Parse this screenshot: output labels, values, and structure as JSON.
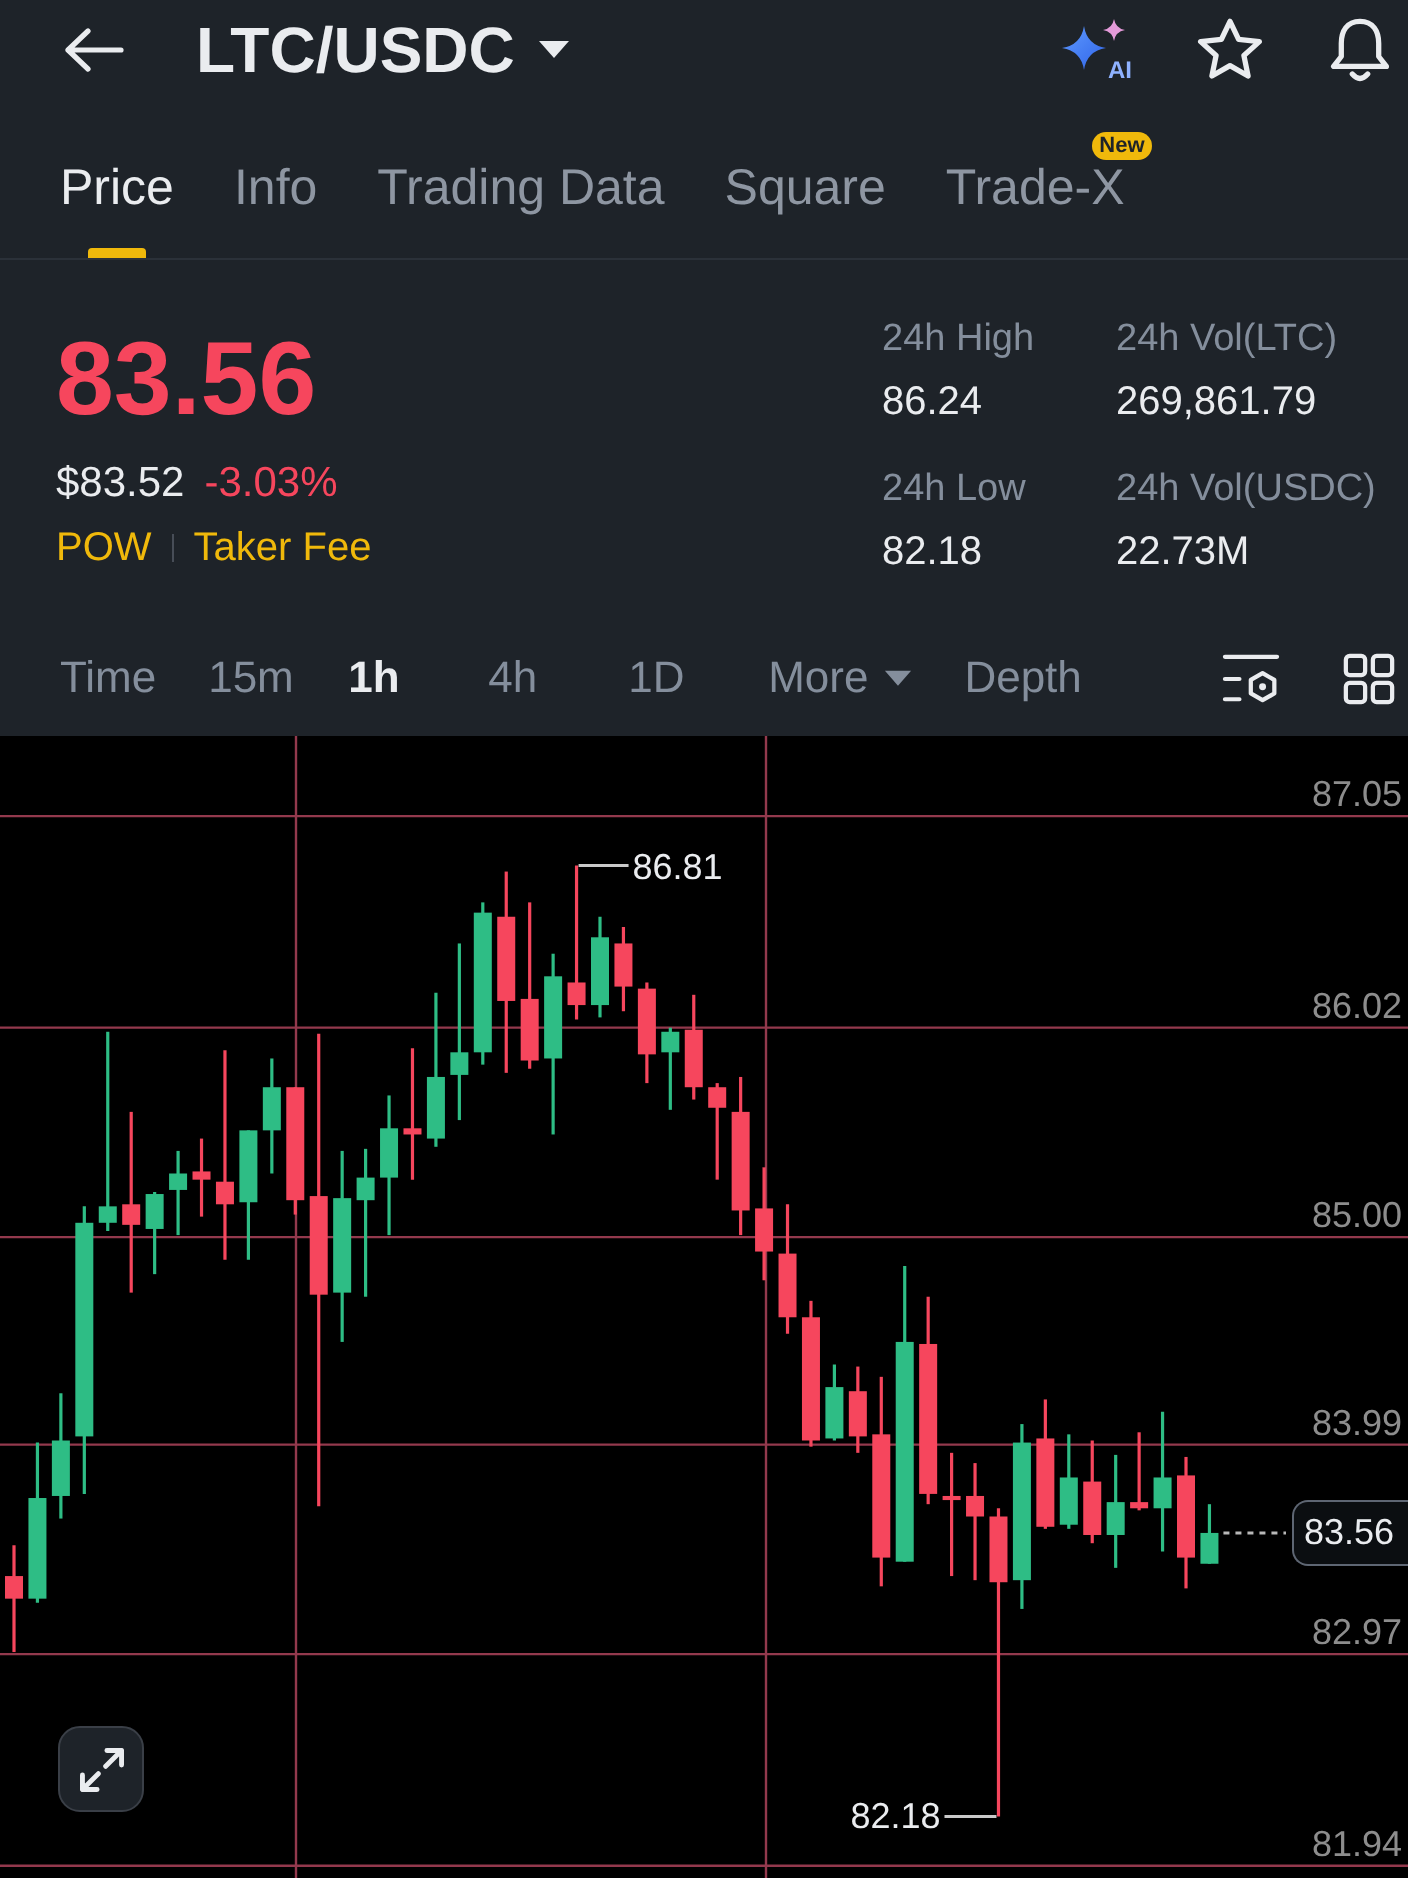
{
  "header": {
    "pair": "LTC/USDC",
    "ai_label": "AI"
  },
  "tabs": [
    {
      "label": "Price",
      "selected": true
    },
    {
      "label": "Info",
      "selected": false
    },
    {
      "label": "Trading Data",
      "selected": false
    },
    {
      "label": "Square",
      "selected": false
    },
    {
      "label": "Trade-X",
      "selected": false,
      "badge": "New"
    }
  ],
  "price": {
    "last": "83.56",
    "falling": true,
    "usd": "$83.52",
    "change": "-3.03%",
    "tags": [
      "POW",
      "Taker Fee"
    ]
  },
  "stats": [
    {
      "label": "24h High",
      "value": "86.24"
    },
    {
      "label": "24h Vol(LTC)",
      "value": "269,861.79"
    },
    {
      "label": "24h Low",
      "value": "82.18"
    },
    {
      "label": "24h Vol(USDC)",
      "value": "22.73M"
    }
  ],
  "intervals": [
    {
      "label": "Time",
      "kind": "option",
      "selected": false
    },
    {
      "label": "15m",
      "kind": "option",
      "selected": false
    },
    {
      "label": "1h",
      "kind": "option",
      "selected": true
    },
    {
      "label": "4h",
      "kind": "option",
      "selected": false
    },
    {
      "label": "1D",
      "kind": "option",
      "selected": false
    },
    {
      "label": "More",
      "kind": "dropdown",
      "selected": false
    },
    {
      "label": "Depth",
      "kind": "option",
      "selected": false
    }
  ],
  "chart": {
    "chart_data": {
      "type": "candlestick",
      "grid": true,
      "ohlc": [
        [
          83.35,
          83.5,
          82.98,
          83.24
        ],
        [
          83.24,
          84.0,
          83.22,
          83.73
        ],
        [
          83.74,
          84.24,
          83.63,
          84.01
        ],
        [
          84.03,
          85.15,
          83.75,
          85.07
        ],
        [
          85.07,
          86.0,
          85.03,
          85.15
        ],
        [
          85.16,
          85.61,
          84.73,
          85.06
        ],
        [
          85.04,
          85.22,
          84.82,
          85.21
        ],
        [
          85.23,
          85.42,
          85.01,
          85.31
        ],
        [
          85.32,
          85.48,
          85.1,
          85.28
        ],
        [
          85.27,
          85.91,
          84.89,
          85.16
        ],
        [
          85.17,
          85.52,
          84.89,
          85.52
        ],
        [
          85.52,
          85.87,
          85.31,
          85.73
        ],
        [
          85.73,
          85.73,
          85.11,
          85.18
        ],
        [
          85.2,
          85.99,
          83.69,
          84.72
        ],
        [
          84.73,
          85.42,
          84.49,
          85.19
        ],
        [
          85.18,
          85.43,
          84.71,
          85.29
        ],
        [
          85.29,
          85.69,
          85.01,
          85.53
        ],
        [
          85.53,
          85.92,
          85.28,
          85.5
        ],
        [
          85.48,
          86.19,
          85.44,
          85.78
        ],
        [
          85.79,
          86.43,
          85.57,
          85.9
        ],
        [
          85.9,
          86.63,
          85.84,
          86.58
        ],
        [
          86.56,
          86.78,
          85.8,
          86.15
        ],
        [
          86.16,
          86.63,
          85.82,
          85.86
        ],
        [
          85.87,
          86.38,
          85.5,
          86.27
        ],
        [
          86.24,
          86.81,
          86.06,
          86.13
        ],
        [
          86.13,
          86.56,
          86.07,
          86.46
        ],
        [
          86.43,
          86.51,
          86.1,
          86.22
        ],
        [
          86.21,
          86.24,
          85.75,
          85.89
        ],
        [
          85.9,
          86.02,
          85.62,
          86.0
        ],
        [
          86.01,
          86.18,
          85.67,
          85.73
        ],
        [
          85.73,
          85.75,
          85.28,
          85.63
        ],
        [
          85.61,
          85.78,
          85.01,
          85.13
        ],
        [
          85.14,
          85.34,
          84.79,
          84.93
        ],
        [
          84.92,
          85.16,
          84.53,
          84.61
        ],
        [
          84.61,
          84.69,
          83.98,
          84.01
        ],
        [
          84.02,
          84.38,
          84.01,
          84.27
        ],
        [
          84.25,
          84.37,
          83.95,
          84.03
        ],
        [
          84.04,
          84.32,
          83.3,
          83.44
        ],
        [
          83.42,
          84.86,
          83.42,
          84.49
        ],
        [
          84.48,
          84.71,
          83.7,
          83.75
        ],
        [
          83.74,
          83.95,
          83.35,
          83.72
        ],
        [
          83.74,
          83.9,
          83.33,
          83.64
        ],
        [
          83.64,
          83.68,
          82.18,
          83.32
        ],
        [
          83.33,
          84.09,
          83.19,
          84.0
        ],
        [
          84.02,
          84.21,
          83.58,
          83.59
        ],
        [
          83.6,
          84.04,
          83.58,
          83.83
        ],
        [
          83.81,
          84.01,
          83.51,
          83.55
        ],
        [
          83.55,
          83.94,
          83.39,
          83.71
        ],
        [
          83.71,
          84.05,
          83.67,
          83.68
        ],
        [
          83.68,
          84.15,
          83.47,
          83.83
        ],
        [
          83.84,
          83.93,
          83.29,
          83.44
        ],
        [
          83.41,
          83.7,
          83.41,
          83.56
        ]
      ],
      "ylim": [
        81.88,
        87.44
      ],
      "yticks": [
        {
          "value": 87.05,
          "label": "87.05"
        },
        {
          "value": 86.02,
          "label": "86.02"
        },
        {
          "value": 85.0,
          "label": "85.00"
        },
        {
          "value": 83.99,
          "label": "83.99"
        },
        {
          "value": 82.97,
          "label": "82.97"
        },
        {
          "value": 81.94,
          "label": "81.94"
        }
      ]
    },
    "high_marker": "86.81",
    "low_marker": "82.18",
    "last_price": "83.56"
  }
}
